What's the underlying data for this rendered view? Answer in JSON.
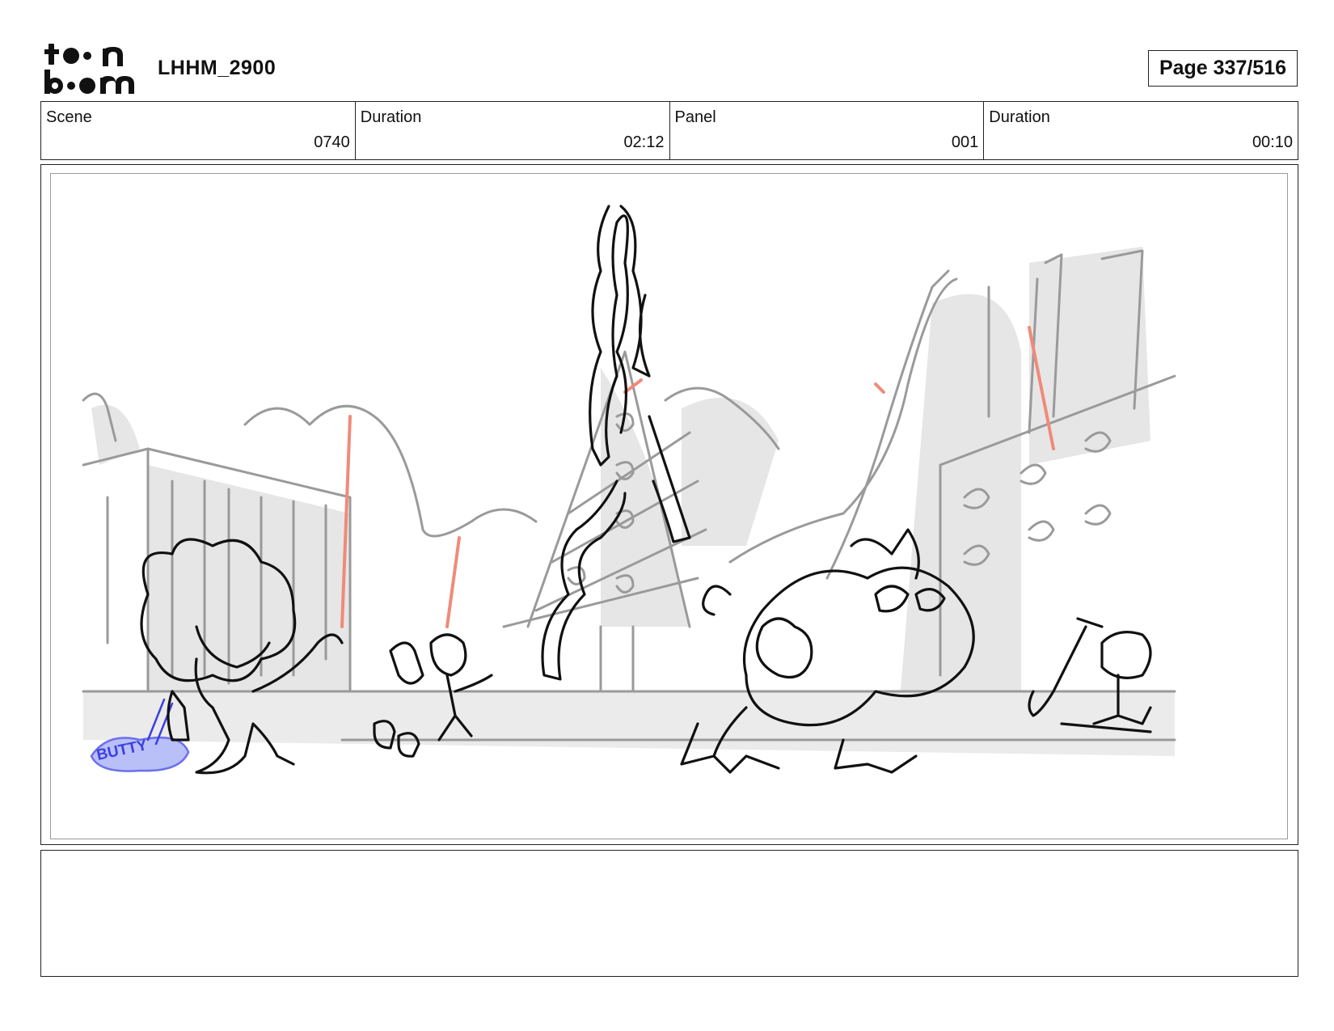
{
  "header": {
    "logo_text": "toon boom",
    "project": "LHHM_2900",
    "page": "Page 337/516"
  },
  "info": {
    "scene_label": "Scene",
    "scene_value": "0740",
    "duration_label": "Duration",
    "duration_value": "02:12",
    "panel_label": "Panel",
    "panel_value": "001",
    "panel_duration_label": "Duration",
    "panel_duration_value": "00:10"
  },
  "panel_art": {
    "graffiti_text": "BUTTY"
  },
  "notes": {
    "text": ""
  },
  "colors": {
    "ink": "#111111",
    "sketch_gray": "#9a9a9a",
    "tone_gray": "#e4e4e4",
    "guide_red": "#f08a7a",
    "graffiti_blue": "#3b3fe0"
  }
}
